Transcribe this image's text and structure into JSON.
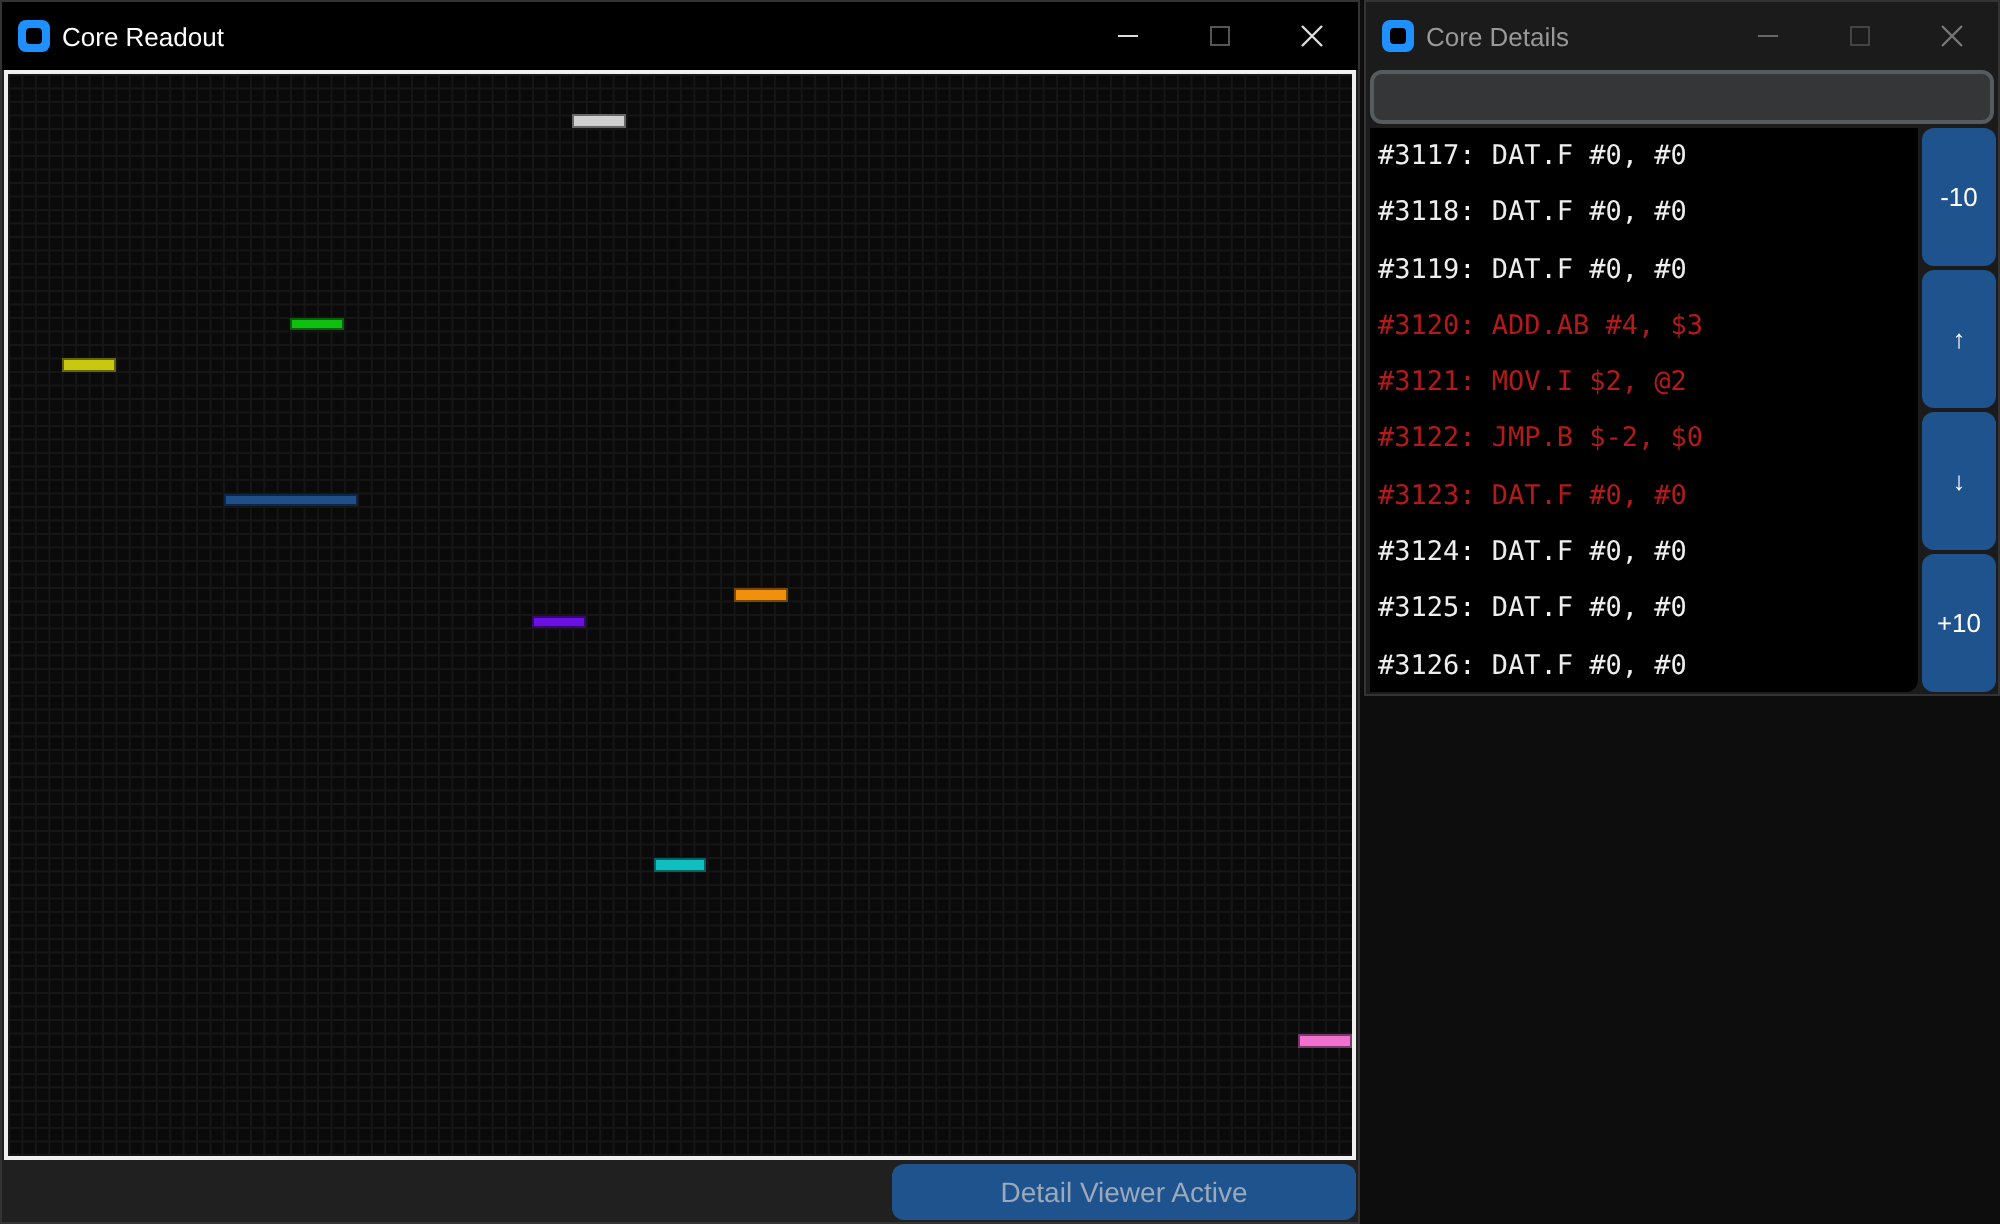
{
  "main_window": {
    "title": "Core Readout"
  },
  "core_map": {
    "segments": [
      {
        "color": "#d0d0d0"
      },
      {
        "color": "#10c010"
      },
      {
        "color": "#c8c810"
      },
      {
        "color": "#1f4f88"
      },
      {
        "color": "#f0900c"
      },
      {
        "color": "#6a10e0"
      },
      {
        "color": "#10c0c0"
      },
      {
        "color": "#f070d0"
      }
    ]
  },
  "status_button": {
    "label": "Detail Viewer Active",
    "disabled": true
  },
  "detail_window": {
    "title": "Core Details"
  },
  "instructions": [
    {
      "text": "#3117: DAT.F #0, #0",
      "highlighted": false
    },
    {
      "text": "#3118: DAT.F #0, #0",
      "highlighted": false
    },
    {
      "text": "#3119: DAT.F #0, #0",
      "highlighted": false
    },
    {
      "text": "#3120: ADD.AB #4, $3",
      "highlighted": true
    },
    {
      "text": "#3121: MOV.I $2, @2",
      "highlighted": true
    },
    {
      "text": "#3122: JMP.B $-2, $0",
      "highlighted": true
    },
    {
      "text": "#3123: DAT.F #0, #0",
      "highlighted": true
    },
    {
      "text": "#3124: DAT.F #0, #0",
      "highlighted": false
    },
    {
      "text": "#3125: DAT.F #0, #0",
      "highlighted": false
    },
    {
      "text": "#3126: DAT.F #0, #0",
      "highlighted": false
    }
  ],
  "nav_buttons": [
    "-10",
    "↑",
    "↓",
    "+10"
  ]
}
